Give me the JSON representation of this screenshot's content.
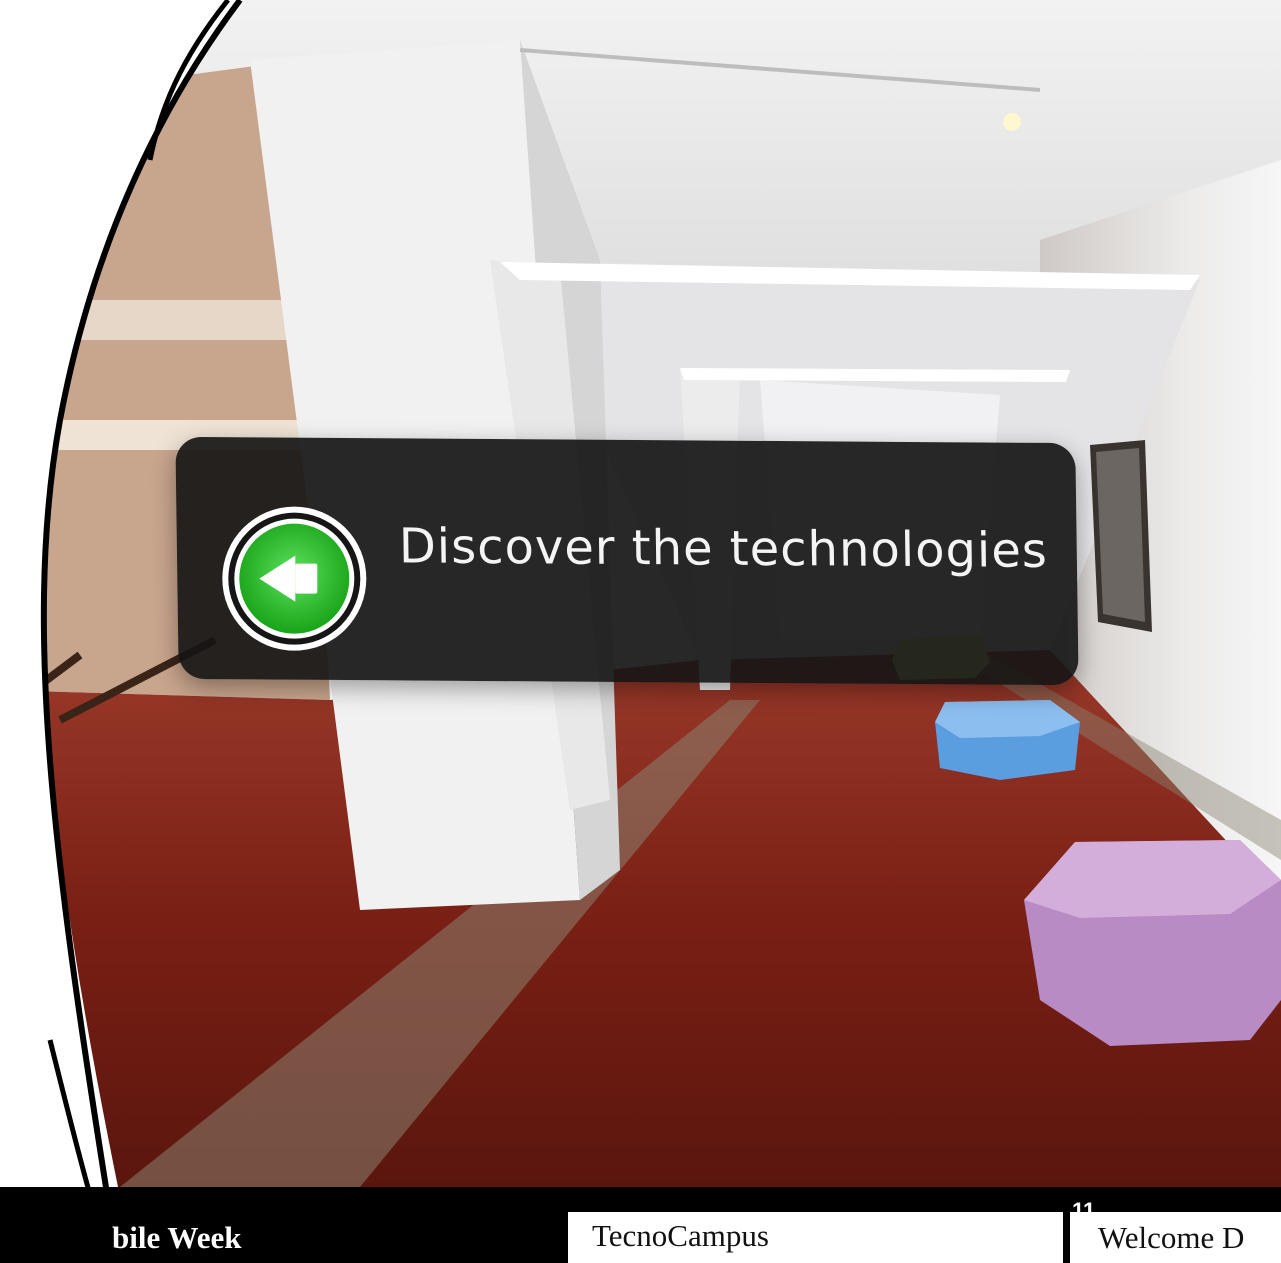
{
  "vr_overlay": {
    "label": "Discover the technologies",
    "icon": "audio-speaker-icon",
    "accent": "#22b422"
  },
  "footer": {
    "left_caption": "bile Week",
    "middle_caption": "TecnoCampus",
    "right_caption": "Welcome D",
    "page_number": "11"
  },
  "colors": {
    "floor": "#7a1f14",
    "wall": "#e9e7e6",
    "ottoman_yellow": "#d9e36a",
    "ottoman_blue": "#5b9ee0",
    "ottoman_purple": "#b98bc4"
  }
}
